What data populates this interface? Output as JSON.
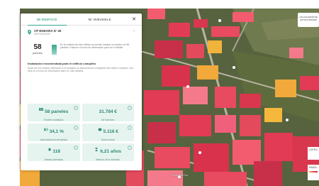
{
  "header": {
    "logo": "CALCULADOR DE AUTOCONSUMO"
  },
  "tabs": [
    {
      "label": "MI EDIFICIO",
      "active": true
    },
    {
      "label": "MI INMUEBLE",
      "active": false
    }
  ],
  "address": {
    "main": "CP ENDARA D' 40",
    "sub": "6200000000000"
  },
  "summary": {
    "count": "58",
    "count_label": "paneles",
    "description": "En la cubierta de este edificio se pueden instalar un máximo de 58 paneles. Pulsa en el icono de información para ver el detalle."
  },
  "section": {
    "title": "Instalación recomendada para el edificio completo",
    "description": "Estos son los valores estimados si se instalara un autoconsumo compartido del edificio completo. Haz click en el icono de información para ver más detalles."
  },
  "cards": [
    {
      "value": "58 paneles",
      "label": "Paneles instalados",
      "icon": "solar-panel-icon"
    },
    {
      "value": "31.784 €",
      "label": "De inversión",
      "icon": ""
    },
    {
      "value": "34,1 %",
      "label": "Autosuficiencia energética",
      "icon": "battery-icon"
    },
    {
      "value": "5.116 €",
      "label": "Ahorro anual",
      "icon": "piggy-bank-icon"
    },
    {
      "value": "118",
      "label": "Árboles plantados",
      "icon": "tree-icon"
    },
    {
      "value": "6,21 años",
      "label": "Retorno de la inversión",
      "icon": "hourglass-icon"
    }
  ],
  "map": {
    "street_label": "Carrer del Pou",
    "legend_title": "CATEG",
    "legend_title_2": "RADIA"
  },
  "colors": {
    "accent": "#3aa58d",
    "card_bg": "#e6f4f0"
  }
}
